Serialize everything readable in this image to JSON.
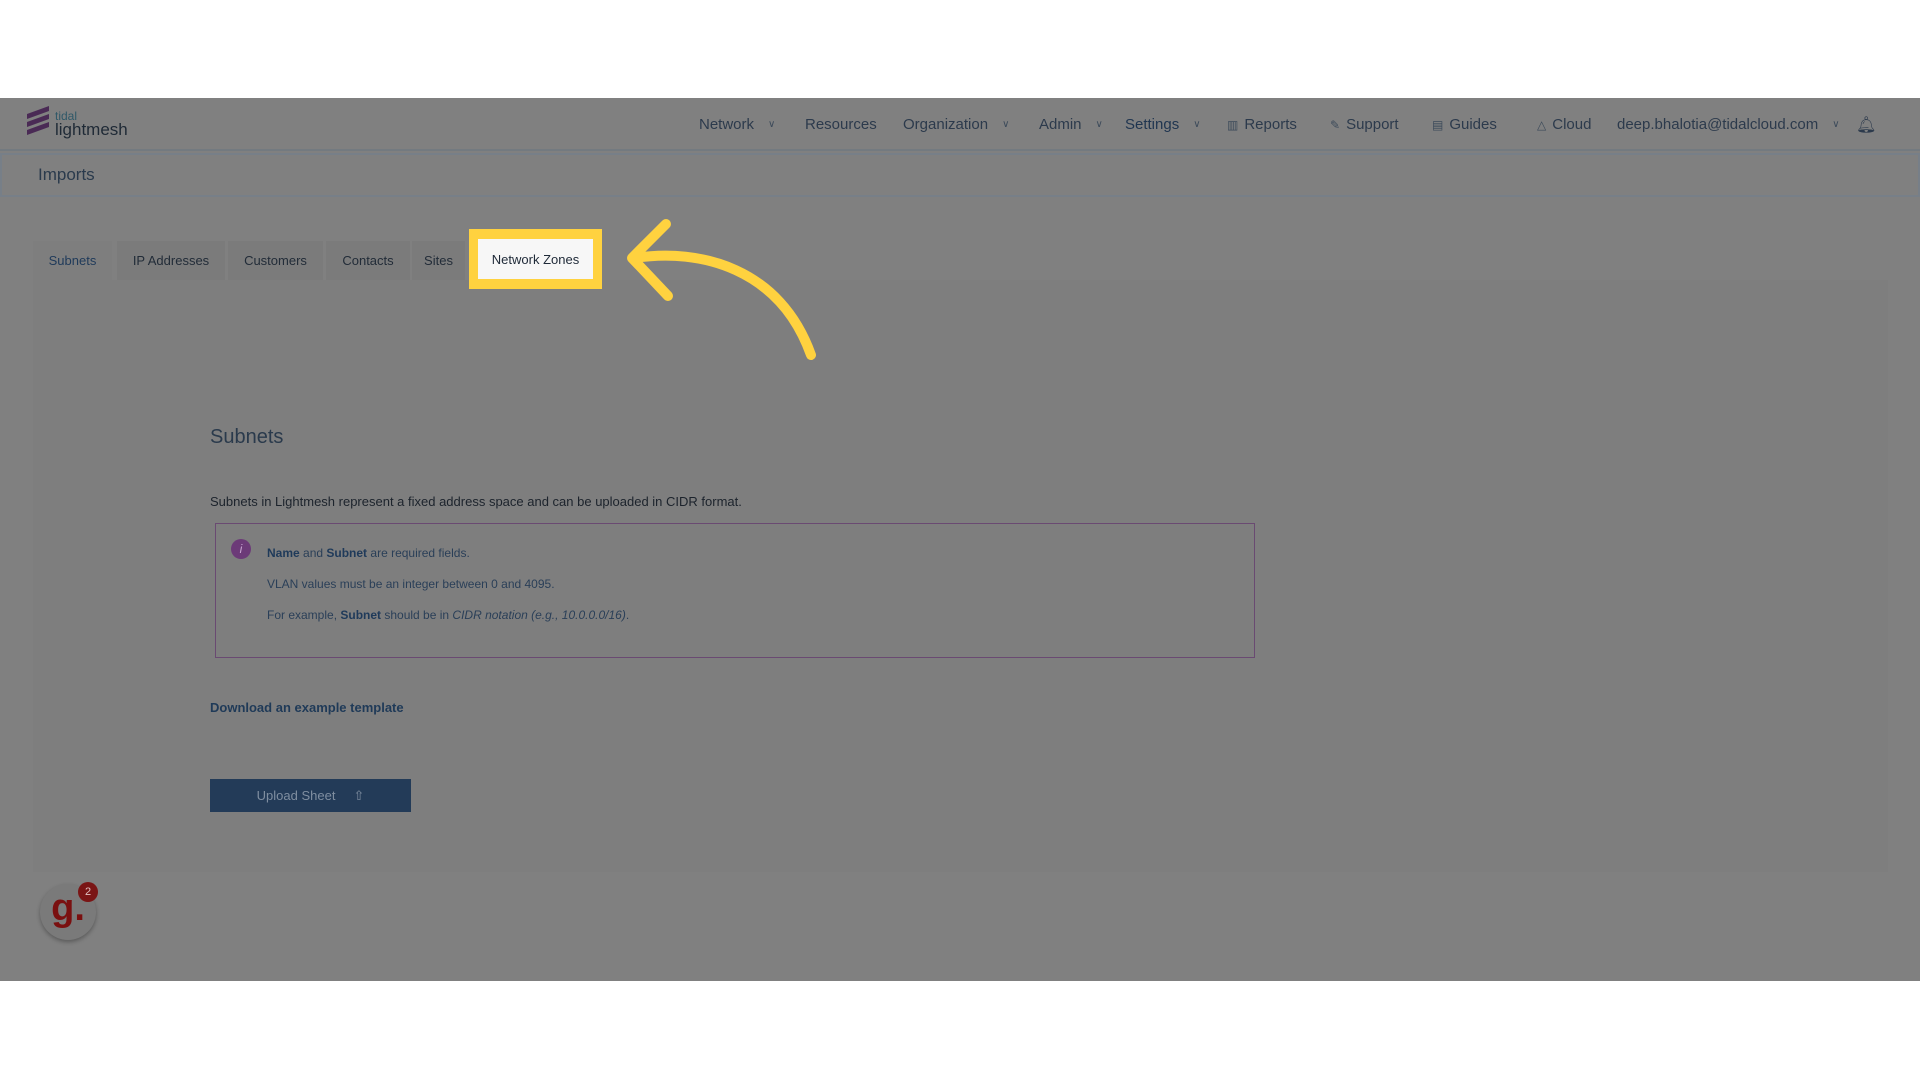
{
  "logo": {
    "line1": "tidal",
    "line2": "lightmesh"
  },
  "nav": {
    "network": "Network",
    "resources": "Resources",
    "organization": "Organization",
    "admin": "Admin",
    "settings": "Settings",
    "reports": "Reports",
    "support": "Support",
    "guides": "Guides",
    "cloud": "Cloud",
    "user": "deep.bhalotia@tidalcloud.com"
  },
  "page": {
    "title": "Imports"
  },
  "tabs": [
    "Subnets",
    "IP Addresses",
    "Customers",
    "Contacts",
    "Sites",
    "Network Zones"
  ],
  "content": {
    "heading": "Subnets",
    "description": "Subnets in Lightmesh represent a fixed address space and can be uploaded in CIDR format.",
    "info": {
      "l1_b1": "Name",
      "l1_t1": " and ",
      "l1_b2": "Subnet",
      "l1_t2": " are required fields.",
      "l2": "VLAN values must be an integer between 0 and 4095.",
      "l3_t1": "For example, ",
      "l3_b1": "Subnet",
      "l3_t2": " should be in ",
      "l3_i1": "CIDR notation (e.g., 10.0.0.0/16)",
      "l3_t3": "."
    },
    "download_link": "Download an example template",
    "upload_button": "Upload Sheet"
  },
  "guidde": {
    "logo": "g.",
    "badge": "2"
  },
  "colors": {
    "highlight": "#ffd23f",
    "primary": "#233b58",
    "info_border": "#6a4a72"
  }
}
